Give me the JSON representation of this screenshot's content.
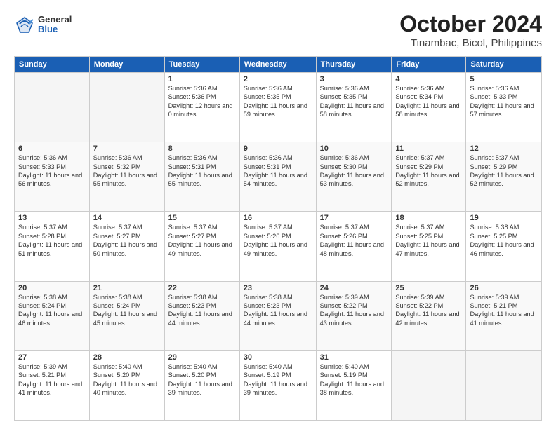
{
  "header": {
    "logo": {
      "general": "General",
      "blue": "Blue"
    },
    "title": "October 2024",
    "subtitle": "Tinambac, Bicol, Philippines"
  },
  "days_of_week": [
    "Sunday",
    "Monday",
    "Tuesday",
    "Wednesday",
    "Thursday",
    "Friday",
    "Saturday"
  ],
  "weeks": [
    [
      {
        "day": "",
        "empty": true
      },
      {
        "day": "",
        "empty": true
      },
      {
        "day": "1",
        "sunrise": "Sunrise: 5:36 AM",
        "sunset": "Sunset: 5:36 PM",
        "daylight": "Daylight: 12 hours and 0 minutes."
      },
      {
        "day": "2",
        "sunrise": "Sunrise: 5:36 AM",
        "sunset": "Sunset: 5:35 PM",
        "daylight": "Daylight: 11 hours and 59 minutes."
      },
      {
        "day": "3",
        "sunrise": "Sunrise: 5:36 AM",
        "sunset": "Sunset: 5:35 PM",
        "daylight": "Daylight: 11 hours and 58 minutes."
      },
      {
        "day": "4",
        "sunrise": "Sunrise: 5:36 AM",
        "sunset": "Sunset: 5:34 PM",
        "daylight": "Daylight: 11 hours and 58 minutes."
      },
      {
        "day": "5",
        "sunrise": "Sunrise: 5:36 AM",
        "sunset": "Sunset: 5:33 PM",
        "daylight": "Daylight: 11 hours and 57 minutes."
      }
    ],
    [
      {
        "day": "6",
        "sunrise": "Sunrise: 5:36 AM",
        "sunset": "Sunset: 5:33 PM",
        "daylight": "Daylight: 11 hours and 56 minutes."
      },
      {
        "day": "7",
        "sunrise": "Sunrise: 5:36 AM",
        "sunset": "Sunset: 5:32 PM",
        "daylight": "Daylight: 11 hours and 55 minutes."
      },
      {
        "day": "8",
        "sunrise": "Sunrise: 5:36 AM",
        "sunset": "Sunset: 5:31 PM",
        "daylight": "Daylight: 11 hours and 55 minutes."
      },
      {
        "day": "9",
        "sunrise": "Sunrise: 5:36 AM",
        "sunset": "Sunset: 5:31 PM",
        "daylight": "Daylight: 11 hours and 54 minutes."
      },
      {
        "day": "10",
        "sunrise": "Sunrise: 5:36 AM",
        "sunset": "Sunset: 5:30 PM",
        "daylight": "Daylight: 11 hours and 53 minutes."
      },
      {
        "day": "11",
        "sunrise": "Sunrise: 5:37 AM",
        "sunset": "Sunset: 5:29 PM",
        "daylight": "Daylight: 11 hours and 52 minutes."
      },
      {
        "day": "12",
        "sunrise": "Sunrise: 5:37 AM",
        "sunset": "Sunset: 5:29 PM",
        "daylight": "Daylight: 11 hours and 52 minutes."
      }
    ],
    [
      {
        "day": "13",
        "sunrise": "Sunrise: 5:37 AM",
        "sunset": "Sunset: 5:28 PM",
        "daylight": "Daylight: 11 hours and 51 minutes."
      },
      {
        "day": "14",
        "sunrise": "Sunrise: 5:37 AM",
        "sunset": "Sunset: 5:27 PM",
        "daylight": "Daylight: 11 hours and 50 minutes."
      },
      {
        "day": "15",
        "sunrise": "Sunrise: 5:37 AM",
        "sunset": "Sunset: 5:27 PM",
        "daylight": "Daylight: 11 hours and 49 minutes."
      },
      {
        "day": "16",
        "sunrise": "Sunrise: 5:37 AM",
        "sunset": "Sunset: 5:26 PM",
        "daylight": "Daylight: 11 hours and 49 minutes."
      },
      {
        "day": "17",
        "sunrise": "Sunrise: 5:37 AM",
        "sunset": "Sunset: 5:26 PM",
        "daylight": "Daylight: 11 hours and 48 minutes."
      },
      {
        "day": "18",
        "sunrise": "Sunrise: 5:37 AM",
        "sunset": "Sunset: 5:25 PM",
        "daylight": "Daylight: 11 hours and 47 minutes."
      },
      {
        "day": "19",
        "sunrise": "Sunrise: 5:38 AM",
        "sunset": "Sunset: 5:25 PM",
        "daylight": "Daylight: 11 hours and 46 minutes."
      }
    ],
    [
      {
        "day": "20",
        "sunrise": "Sunrise: 5:38 AM",
        "sunset": "Sunset: 5:24 PM",
        "daylight": "Daylight: 11 hours and 46 minutes."
      },
      {
        "day": "21",
        "sunrise": "Sunrise: 5:38 AM",
        "sunset": "Sunset: 5:24 PM",
        "daylight": "Daylight: 11 hours and 45 minutes."
      },
      {
        "day": "22",
        "sunrise": "Sunrise: 5:38 AM",
        "sunset": "Sunset: 5:23 PM",
        "daylight": "Daylight: 11 hours and 44 minutes."
      },
      {
        "day": "23",
        "sunrise": "Sunrise: 5:38 AM",
        "sunset": "Sunset: 5:23 PM",
        "daylight": "Daylight: 11 hours and 44 minutes."
      },
      {
        "day": "24",
        "sunrise": "Sunrise: 5:39 AM",
        "sunset": "Sunset: 5:22 PM",
        "daylight": "Daylight: 11 hours and 43 minutes."
      },
      {
        "day": "25",
        "sunrise": "Sunrise: 5:39 AM",
        "sunset": "Sunset: 5:22 PM",
        "daylight": "Daylight: 11 hours and 42 minutes."
      },
      {
        "day": "26",
        "sunrise": "Sunrise: 5:39 AM",
        "sunset": "Sunset: 5:21 PM",
        "daylight": "Daylight: 11 hours and 41 minutes."
      }
    ],
    [
      {
        "day": "27",
        "sunrise": "Sunrise: 5:39 AM",
        "sunset": "Sunset: 5:21 PM",
        "daylight": "Daylight: 11 hours and 41 minutes."
      },
      {
        "day": "28",
        "sunrise": "Sunrise: 5:40 AM",
        "sunset": "Sunset: 5:20 PM",
        "daylight": "Daylight: 11 hours and 40 minutes."
      },
      {
        "day": "29",
        "sunrise": "Sunrise: 5:40 AM",
        "sunset": "Sunset: 5:20 PM",
        "daylight": "Daylight: 11 hours and 39 minutes."
      },
      {
        "day": "30",
        "sunrise": "Sunrise: 5:40 AM",
        "sunset": "Sunset: 5:19 PM",
        "daylight": "Daylight: 11 hours and 39 minutes."
      },
      {
        "day": "31",
        "sunrise": "Sunrise: 5:40 AM",
        "sunset": "Sunset: 5:19 PM",
        "daylight": "Daylight: 11 hours and 38 minutes."
      },
      {
        "day": "",
        "empty": true
      },
      {
        "day": "",
        "empty": true
      }
    ]
  ]
}
